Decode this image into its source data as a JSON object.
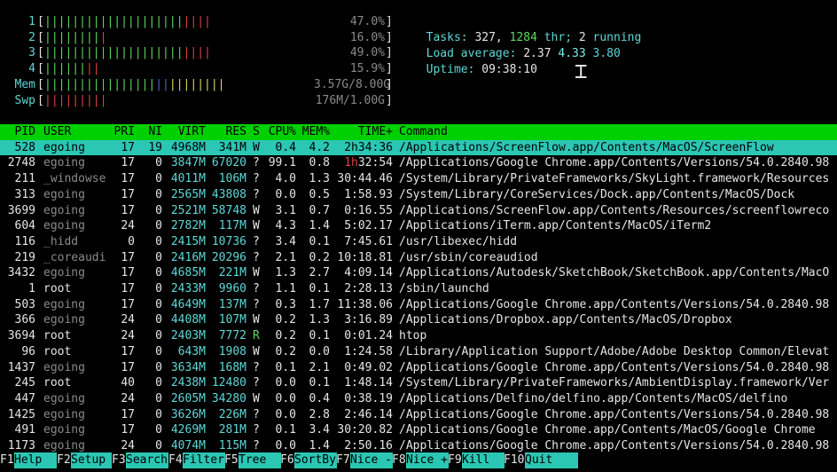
{
  "cpu_meters": [
    {
      "label": "1",
      "value": "47.0%",
      "green": "||||||||||||||||||||",
      "red": "||||"
    },
    {
      "label": "2",
      "value": "16.0%",
      "green": "||||||||",
      "red": "|"
    },
    {
      "label": "3",
      "value": "49.0%",
      "green": "||||||||||||||||||||",
      "red": "||||"
    },
    {
      "label": "4",
      "value": "15.9%",
      "green": "||||||",
      "red": "||"
    }
  ],
  "mem": {
    "label": "Mem",
    "value": "3.57G/8.00G",
    "green": "||||||||||||||||",
    "blue": "||",
    "yellow": "||||||||"
  },
  "swp": {
    "label": "Swp",
    "value": "176M/1.00G",
    "red": "|||||||||"
  },
  "stats": {
    "tasks_label": "Tasks:",
    "tasks": "327,",
    "threads": "1284",
    "thr_label": "thr;",
    "running": "2",
    "running_label": "running",
    "load_label": "Load average:",
    "load1": "2.37",
    "load5": "4.33",
    "load15": "3.80",
    "uptime_label": "Uptime:",
    "uptime": "09:38:10"
  },
  "columns": {
    "pid": "PID",
    "user": "USER",
    "pri": "PRI",
    "ni": "NI",
    "virt": "VIRT",
    "res": "RES",
    "s": "S",
    "cpu": "CPU%",
    "mem": "MEM%",
    "time": "TIME+",
    "command": "Command"
  },
  "selected": {
    "pid": "528",
    "user": "egoing",
    "pri": "17",
    "ni": "19",
    "virt": "4968M",
    "res": "341M",
    "s": "W",
    "cpu": "0.4",
    "mem": "4.2",
    "time": "2h34:36",
    "command": "/Applications/ScreenFlow.app/Contents/MacOS/ScreenFlow"
  },
  "processes": [
    {
      "pid": "2748",
      "user": "egoing",
      "pri": "17",
      "ni": "0",
      "virt": "3847M",
      "res": "67020",
      "s": "?",
      "cpu": "99.1",
      "mem": "0.8",
      "time_hi": "1h",
      "time": "32:54",
      "command": "/Applications/Google Chrome.app/Contents/Versions/54.0.2840.98"
    },
    {
      "pid": "211",
      "user": "_windowse",
      "pri": "17",
      "ni": "0",
      "virt": "4011M",
      "res": "106M",
      "s": "?",
      "cpu": "4.0",
      "mem": "1.3",
      "time": "30:44.46",
      "command": "/System/Library/PrivateFrameworks/SkyLight.framework/Resources"
    },
    {
      "pid": "313",
      "user": "egoing",
      "pri": "17",
      "ni": "0",
      "virt": "2565M",
      "res": "43808",
      "s": "?",
      "cpu": "0.0",
      "mem": "0.5",
      "time": "1:58.93",
      "command": "/System/Library/CoreServices/Dock.app/Contents/MacOS/Dock"
    },
    {
      "pid": "3699",
      "user": "egoing",
      "pri": "17",
      "ni": "0",
      "virt": "2521M",
      "res": "58748",
      "s": "W",
      "cpu": "3.1",
      "mem": "0.7",
      "time": "0:16.55",
      "command": "/Applications/ScreenFlow.app/Contents/Resources/screenflowreco"
    },
    {
      "pid": "604",
      "user": "egoing",
      "pri": "24",
      "ni": "0",
      "virt": "2782M",
      "res": "117M",
      "s": "W",
      "cpu": "4.3",
      "mem": "1.4",
      "time": "5:02.17",
      "command": "/Applications/iTerm.app/Contents/MacOS/iTerm2"
    },
    {
      "pid": "116",
      "user": "_hidd",
      "pri": "0",
      "ni": "0",
      "virt": "2415M",
      "res": "10736",
      "s": "?",
      "cpu": "3.4",
      "mem": "0.1",
      "time": "7:45.61",
      "command": "/usr/libexec/hidd"
    },
    {
      "pid": "219",
      "user": "_coreaudi",
      "pri": "17",
      "ni": "0",
      "virt": "2416M",
      "res": "20296",
      "s": "?",
      "cpu": "2.1",
      "mem": "0.2",
      "time": "10:18.81",
      "command": "/usr/sbin/coreaudiod"
    },
    {
      "pid": "3432",
      "user": "egoing",
      "pri": "17",
      "ni": "0",
      "virt": "4685M",
      "res": "221M",
      "s": "W",
      "cpu": "1.3",
      "mem": "2.7",
      "time": "4:09.14",
      "command": "/Applications/Autodesk/SketchBook/SketchBook.app/Contents/MacO"
    },
    {
      "pid": "1",
      "user": "root",
      "pri": "17",
      "ni": "0",
      "virt": "2433M",
      "res": "9960",
      "s": "?",
      "cpu": "1.1",
      "mem": "0.1",
      "time": "2:28.13",
      "command": "/sbin/launchd"
    },
    {
      "pid": "503",
      "user": "egoing",
      "pri": "17",
      "ni": "0",
      "virt": "4649M",
      "res": "137M",
      "s": "?",
      "cpu": "0.3",
      "mem": "1.7",
      "time": "11:38.06",
      "command": "/Applications/Google Chrome.app/Contents/Versions/54.0.2840.98"
    },
    {
      "pid": "366",
      "user": "egoing",
      "pri": "24",
      "ni": "0",
      "virt": "4408M",
      "res": "107M",
      "s": "W",
      "cpu": "0.2",
      "mem": "1.3",
      "time": "3:16.89",
      "command": "/Applications/Dropbox.app/Contents/MacOS/Dropbox"
    },
    {
      "pid": "3694",
      "user": "root",
      "pri": "24",
      "ni": "0",
      "virt": "2403M",
      "res": "7772",
      "s": "R",
      "cpu": "0.2",
      "mem": "0.1",
      "time": "0:01.24",
      "command": "htop"
    },
    {
      "pid": "96",
      "user": "root",
      "pri": "17",
      "ni": "0",
      "virt": "643M",
      "res": "1908",
      "s": "W",
      "cpu": "0.2",
      "mem": "0.0",
      "time": "1:24.58",
      "command": "/Library/Application Support/Adobe/Adobe Desktop Common/Elevat"
    },
    {
      "pid": "1437",
      "user": "egoing",
      "pri": "17",
      "ni": "0",
      "virt": "3634M",
      "res": "168M",
      "s": "?",
      "cpu": "0.1",
      "mem": "2.1",
      "time": "0:49.02",
      "command": "/Applications/Google Chrome.app/Contents/Versions/54.0.2840.98"
    },
    {
      "pid": "245",
      "user": "root",
      "pri": "40",
      "ni": "0",
      "virt": "2438M",
      "res": "12480",
      "s": "?",
      "cpu": "0.0",
      "mem": "0.1",
      "time": "1:48.14",
      "command": "/System/Library/PrivateFrameworks/AmbientDisplay.framework/Ver"
    },
    {
      "pid": "447",
      "user": "egoing",
      "pri": "24",
      "ni": "0",
      "virt": "2605M",
      "res": "34280",
      "s": "W",
      "cpu": "0.0",
      "mem": "0.4",
      "time": "0:38.19",
      "command": "/Applications/Delfino/delfino.app/Contents/MacOS/delfino"
    },
    {
      "pid": "1425",
      "user": "egoing",
      "pri": "17",
      "ni": "0",
      "virt": "3626M",
      "res": "226M",
      "s": "?",
      "cpu": "0.0",
      "mem": "2.8",
      "time": "2:46.14",
      "command": "/Applications/Google Chrome.app/Contents/Versions/54.0.2840.98"
    },
    {
      "pid": "491",
      "user": "egoing",
      "pri": "17",
      "ni": "0",
      "virt": "4269M",
      "res": "281M",
      "s": "?",
      "cpu": "0.1",
      "mem": "3.4",
      "time": "30:20.82",
      "command": "/Applications/Google Chrome.app/Contents/MacOS/Google Chrome"
    },
    {
      "pid": "1173",
      "user": "egoing",
      "pri": "24",
      "ni": "0",
      "virt": "4074M",
      "res": "115M",
      "s": "?",
      "cpu": "0.0",
      "mem": "1.4",
      "time": "2:50.16",
      "command": "/Applications/Google Chrome.app/Contents/Versions/54.0.2840.98"
    }
  ],
  "footer": [
    {
      "key": "F1",
      "label": "Help"
    },
    {
      "key": "F2",
      "label": "Setup"
    },
    {
      "key": "F3",
      "label": "Search"
    },
    {
      "key": "F4",
      "label": "Filter"
    },
    {
      "key": "F5",
      "label": "Tree"
    },
    {
      "key": "F6",
      "label": "SortBy"
    },
    {
      "key": "F7",
      "label": "Nice -"
    },
    {
      "key": "F8",
      "label": "Nice +"
    },
    {
      "key": "F9",
      "label": "Kill"
    },
    {
      "key": "F10",
      "label": "Quit"
    }
  ],
  "colors": {
    "header_bg": "#00d000",
    "selected_bg": "#2bc6b4",
    "label_cyan": "#5fd7d7",
    "bar_green": "#5fd75f",
    "bar_red": "#e04040"
  },
  "cursor_icon": "text-cursor-icon"
}
